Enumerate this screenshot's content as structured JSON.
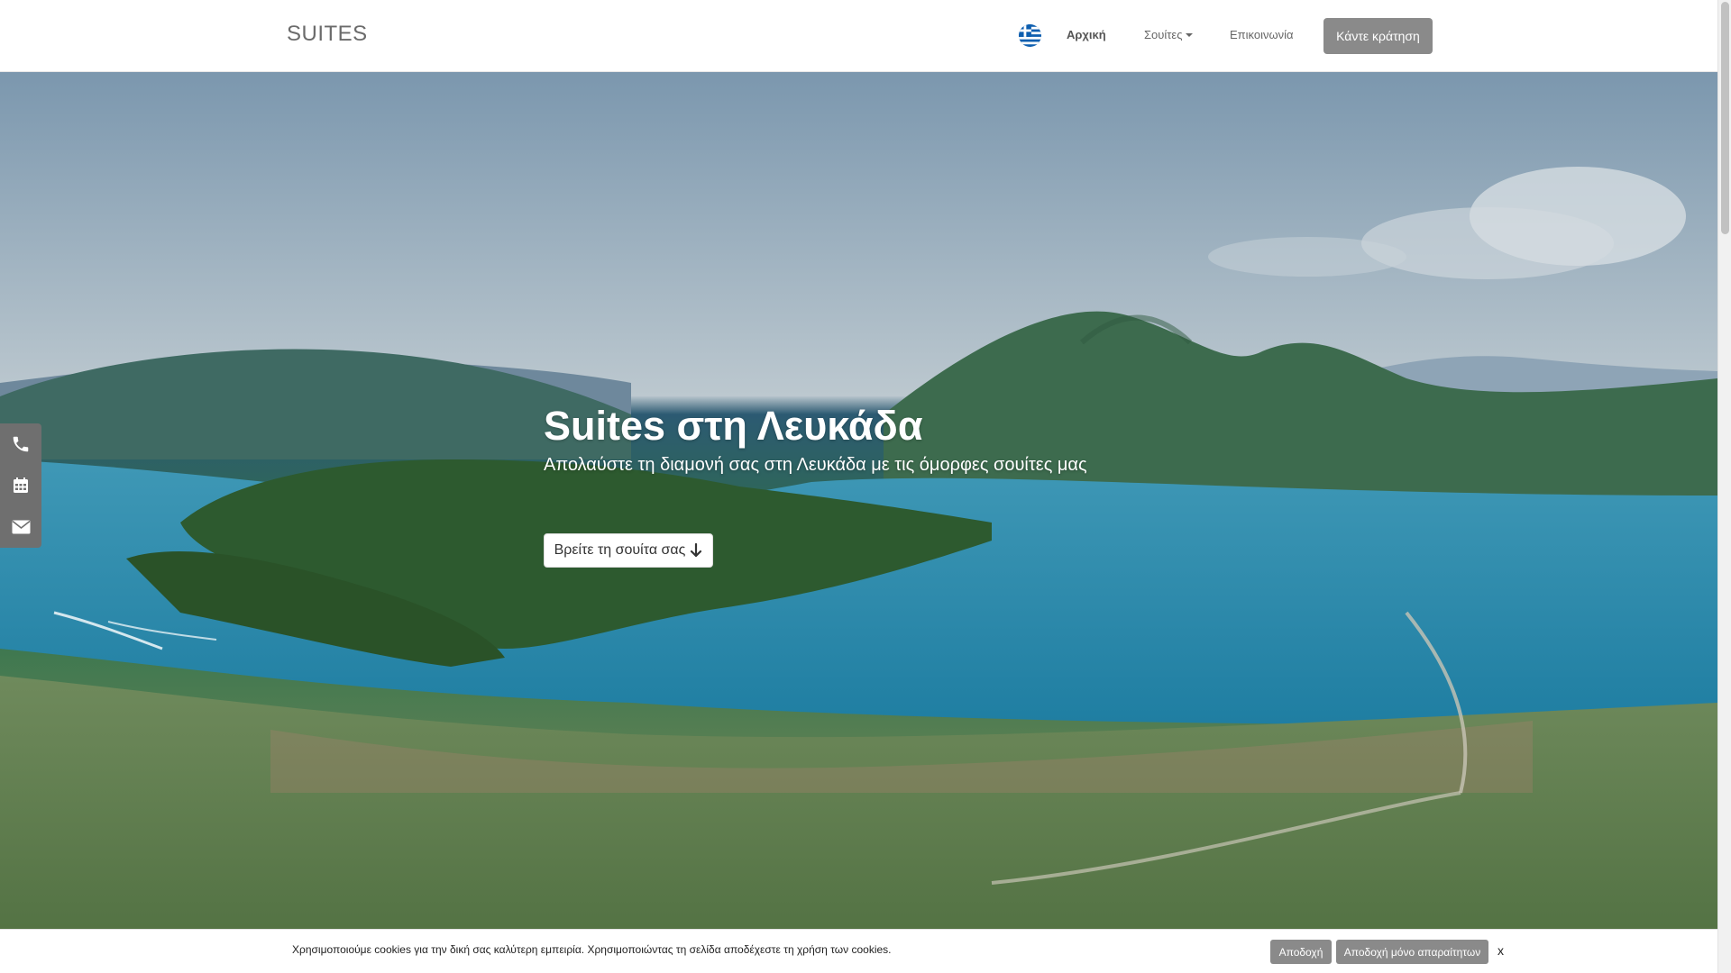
{
  "navbar": {
    "brand": "SUITES",
    "language_flag": "greece-flag-icon",
    "links": [
      {
        "label": "Αρχική",
        "active": true
      },
      {
        "label": "Σουίτες",
        "dropdown": true
      },
      {
        "label": "Επικοινωνία"
      }
    ],
    "book_button": "Κάντε κράτηση"
  },
  "hero": {
    "title": "Suites στη Λευκάδα",
    "subtitle": "Απολαύστε τη διαμονή σας στη Λευκάδα με τις όμορφες σουίτες μας",
    "cta_label": "Βρείτε τη σουίτα σας",
    "cta_icon": "arrow-down-icon",
    "background": "aerial-view-of-lefkada-bay"
  },
  "side_bar": {
    "items": [
      "phone-icon",
      "calendar-icon",
      "envelope-icon"
    ]
  },
  "cookie_bar": {
    "text": "Χρησιμοποιούμε cookies για την δική σας καλύτερη εμπειρία. Χρησιμοποιώντας τη σελίδα αποδέχεστε τη χρήση των cookies.",
    "accept_label": "Αποδοχή",
    "accept_necessary_label": "Αποδοχή μόνο απαραίτητων",
    "close_label": "x"
  },
  "colors": {
    "button_gray": "#8a8a8a",
    "side_bar_gray": "#6f6f6f",
    "brand_text": "#6b6b6b"
  }
}
